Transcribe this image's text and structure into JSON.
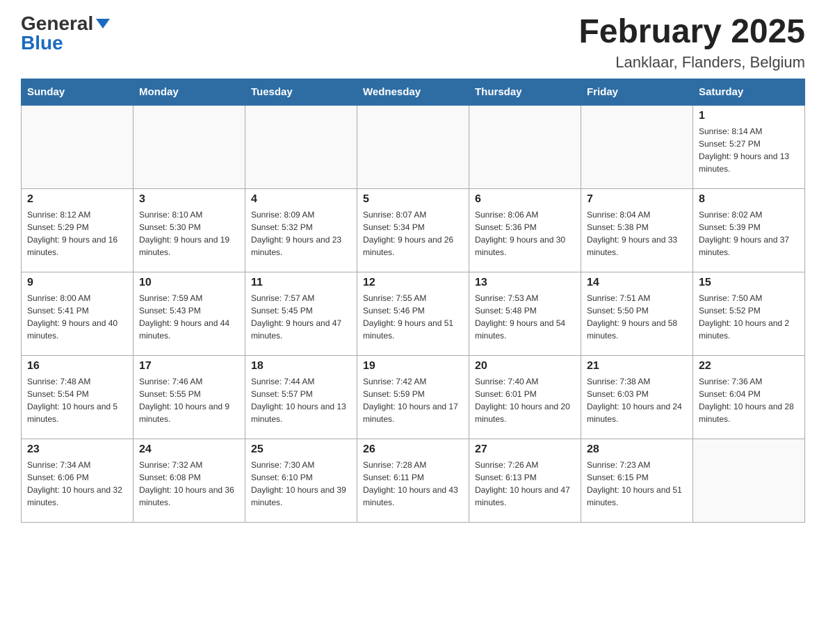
{
  "header": {
    "logo_general": "General",
    "logo_blue": "Blue",
    "title": "February 2025",
    "subtitle": "Lanklaar, Flanders, Belgium"
  },
  "days_of_week": [
    "Sunday",
    "Monday",
    "Tuesday",
    "Wednesday",
    "Thursday",
    "Friday",
    "Saturday"
  ],
  "weeks": [
    {
      "days": [
        {
          "num": "",
          "info": ""
        },
        {
          "num": "",
          "info": ""
        },
        {
          "num": "",
          "info": ""
        },
        {
          "num": "",
          "info": ""
        },
        {
          "num": "",
          "info": ""
        },
        {
          "num": "",
          "info": ""
        },
        {
          "num": "1",
          "info": "Sunrise: 8:14 AM\nSunset: 5:27 PM\nDaylight: 9 hours and 13 minutes."
        }
      ]
    },
    {
      "days": [
        {
          "num": "2",
          "info": "Sunrise: 8:12 AM\nSunset: 5:29 PM\nDaylight: 9 hours and 16 minutes."
        },
        {
          "num": "3",
          "info": "Sunrise: 8:10 AM\nSunset: 5:30 PM\nDaylight: 9 hours and 19 minutes."
        },
        {
          "num": "4",
          "info": "Sunrise: 8:09 AM\nSunset: 5:32 PM\nDaylight: 9 hours and 23 minutes."
        },
        {
          "num": "5",
          "info": "Sunrise: 8:07 AM\nSunset: 5:34 PM\nDaylight: 9 hours and 26 minutes."
        },
        {
          "num": "6",
          "info": "Sunrise: 8:06 AM\nSunset: 5:36 PM\nDaylight: 9 hours and 30 minutes."
        },
        {
          "num": "7",
          "info": "Sunrise: 8:04 AM\nSunset: 5:38 PM\nDaylight: 9 hours and 33 minutes."
        },
        {
          "num": "8",
          "info": "Sunrise: 8:02 AM\nSunset: 5:39 PM\nDaylight: 9 hours and 37 minutes."
        }
      ]
    },
    {
      "days": [
        {
          "num": "9",
          "info": "Sunrise: 8:00 AM\nSunset: 5:41 PM\nDaylight: 9 hours and 40 minutes."
        },
        {
          "num": "10",
          "info": "Sunrise: 7:59 AM\nSunset: 5:43 PM\nDaylight: 9 hours and 44 minutes."
        },
        {
          "num": "11",
          "info": "Sunrise: 7:57 AM\nSunset: 5:45 PM\nDaylight: 9 hours and 47 minutes."
        },
        {
          "num": "12",
          "info": "Sunrise: 7:55 AM\nSunset: 5:46 PM\nDaylight: 9 hours and 51 minutes."
        },
        {
          "num": "13",
          "info": "Sunrise: 7:53 AM\nSunset: 5:48 PM\nDaylight: 9 hours and 54 minutes."
        },
        {
          "num": "14",
          "info": "Sunrise: 7:51 AM\nSunset: 5:50 PM\nDaylight: 9 hours and 58 minutes."
        },
        {
          "num": "15",
          "info": "Sunrise: 7:50 AM\nSunset: 5:52 PM\nDaylight: 10 hours and 2 minutes."
        }
      ]
    },
    {
      "days": [
        {
          "num": "16",
          "info": "Sunrise: 7:48 AM\nSunset: 5:54 PM\nDaylight: 10 hours and 5 minutes."
        },
        {
          "num": "17",
          "info": "Sunrise: 7:46 AM\nSunset: 5:55 PM\nDaylight: 10 hours and 9 minutes."
        },
        {
          "num": "18",
          "info": "Sunrise: 7:44 AM\nSunset: 5:57 PM\nDaylight: 10 hours and 13 minutes."
        },
        {
          "num": "19",
          "info": "Sunrise: 7:42 AM\nSunset: 5:59 PM\nDaylight: 10 hours and 17 minutes."
        },
        {
          "num": "20",
          "info": "Sunrise: 7:40 AM\nSunset: 6:01 PM\nDaylight: 10 hours and 20 minutes."
        },
        {
          "num": "21",
          "info": "Sunrise: 7:38 AM\nSunset: 6:03 PM\nDaylight: 10 hours and 24 minutes."
        },
        {
          "num": "22",
          "info": "Sunrise: 7:36 AM\nSunset: 6:04 PM\nDaylight: 10 hours and 28 minutes."
        }
      ]
    },
    {
      "days": [
        {
          "num": "23",
          "info": "Sunrise: 7:34 AM\nSunset: 6:06 PM\nDaylight: 10 hours and 32 minutes."
        },
        {
          "num": "24",
          "info": "Sunrise: 7:32 AM\nSunset: 6:08 PM\nDaylight: 10 hours and 36 minutes."
        },
        {
          "num": "25",
          "info": "Sunrise: 7:30 AM\nSunset: 6:10 PM\nDaylight: 10 hours and 39 minutes."
        },
        {
          "num": "26",
          "info": "Sunrise: 7:28 AM\nSunset: 6:11 PM\nDaylight: 10 hours and 43 minutes."
        },
        {
          "num": "27",
          "info": "Sunrise: 7:26 AM\nSunset: 6:13 PM\nDaylight: 10 hours and 47 minutes."
        },
        {
          "num": "28",
          "info": "Sunrise: 7:23 AM\nSunset: 6:15 PM\nDaylight: 10 hours and 51 minutes."
        },
        {
          "num": "",
          "info": ""
        }
      ]
    }
  ]
}
